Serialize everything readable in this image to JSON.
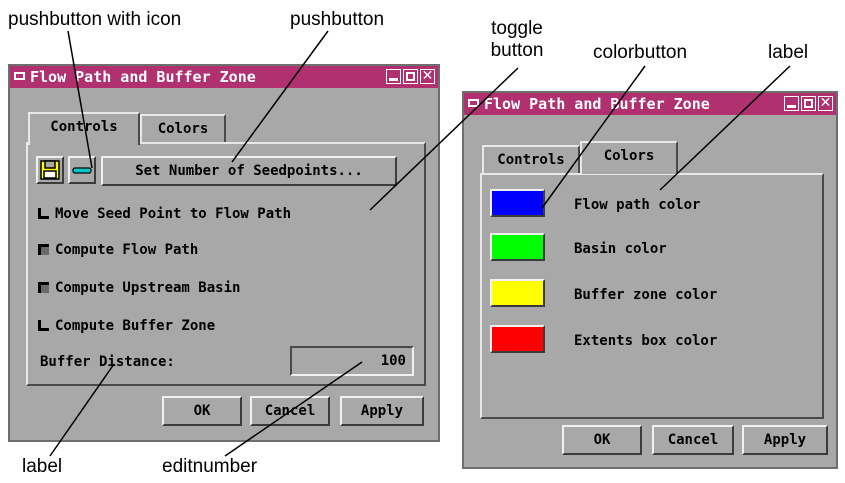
{
  "annotations": {
    "pushbutton_with_icon": "pushbutton with icon",
    "pushbutton": "pushbutton",
    "toggle_line1": "toggle",
    "toggle_line2": "button",
    "colorbutton": "colorbutton",
    "label_top": "label",
    "label_bottom": "label",
    "editnumber": "editnumber"
  },
  "window_left": {
    "title": "Flow Path and Buffer Zone",
    "tabs": [
      "Controls",
      "Colors"
    ],
    "save_icon": "floppy-disk-icon",
    "seed_icon": "line-tool-icon",
    "seedpoints_button": "Set Number of Seedpoints...",
    "toggles": [
      {
        "label": "Move Seed Point to Flow Path",
        "checked": false
      },
      {
        "label": "Compute Flow Path",
        "checked": true
      },
      {
        "label": "Compute Upstream Basin",
        "checked": true
      },
      {
        "label": "Compute Buffer Zone",
        "checked": false
      }
    ],
    "buffer_label": "Buffer Distance:",
    "buffer_value": "100",
    "buttons": {
      "ok": "OK",
      "cancel": "Cancel",
      "apply": "Apply"
    }
  },
  "window_right": {
    "title": "Flow Path and Buffer Zone",
    "tabs": [
      "Controls",
      "Colors"
    ],
    "colors": [
      {
        "label": "Flow path color",
        "color": "#0000ff"
      },
      {
        "label": "Basin color",
        "color": "#00ff00"
      },
      {
        "label": "Buffer zone color",
        "color": "#ffff00"
      },
      {
        "label": "Extents box color",
        "color": "#ff0000"
      }
    ],
    "buttons": {
      "ok": "OK",
      "cancel": "Cancel",
      "apply": "Apply"
    }
  },
  "colors": {
    "titlebar": "#b03070",
    "window_bg": "#a8a8a8"
  }
}
